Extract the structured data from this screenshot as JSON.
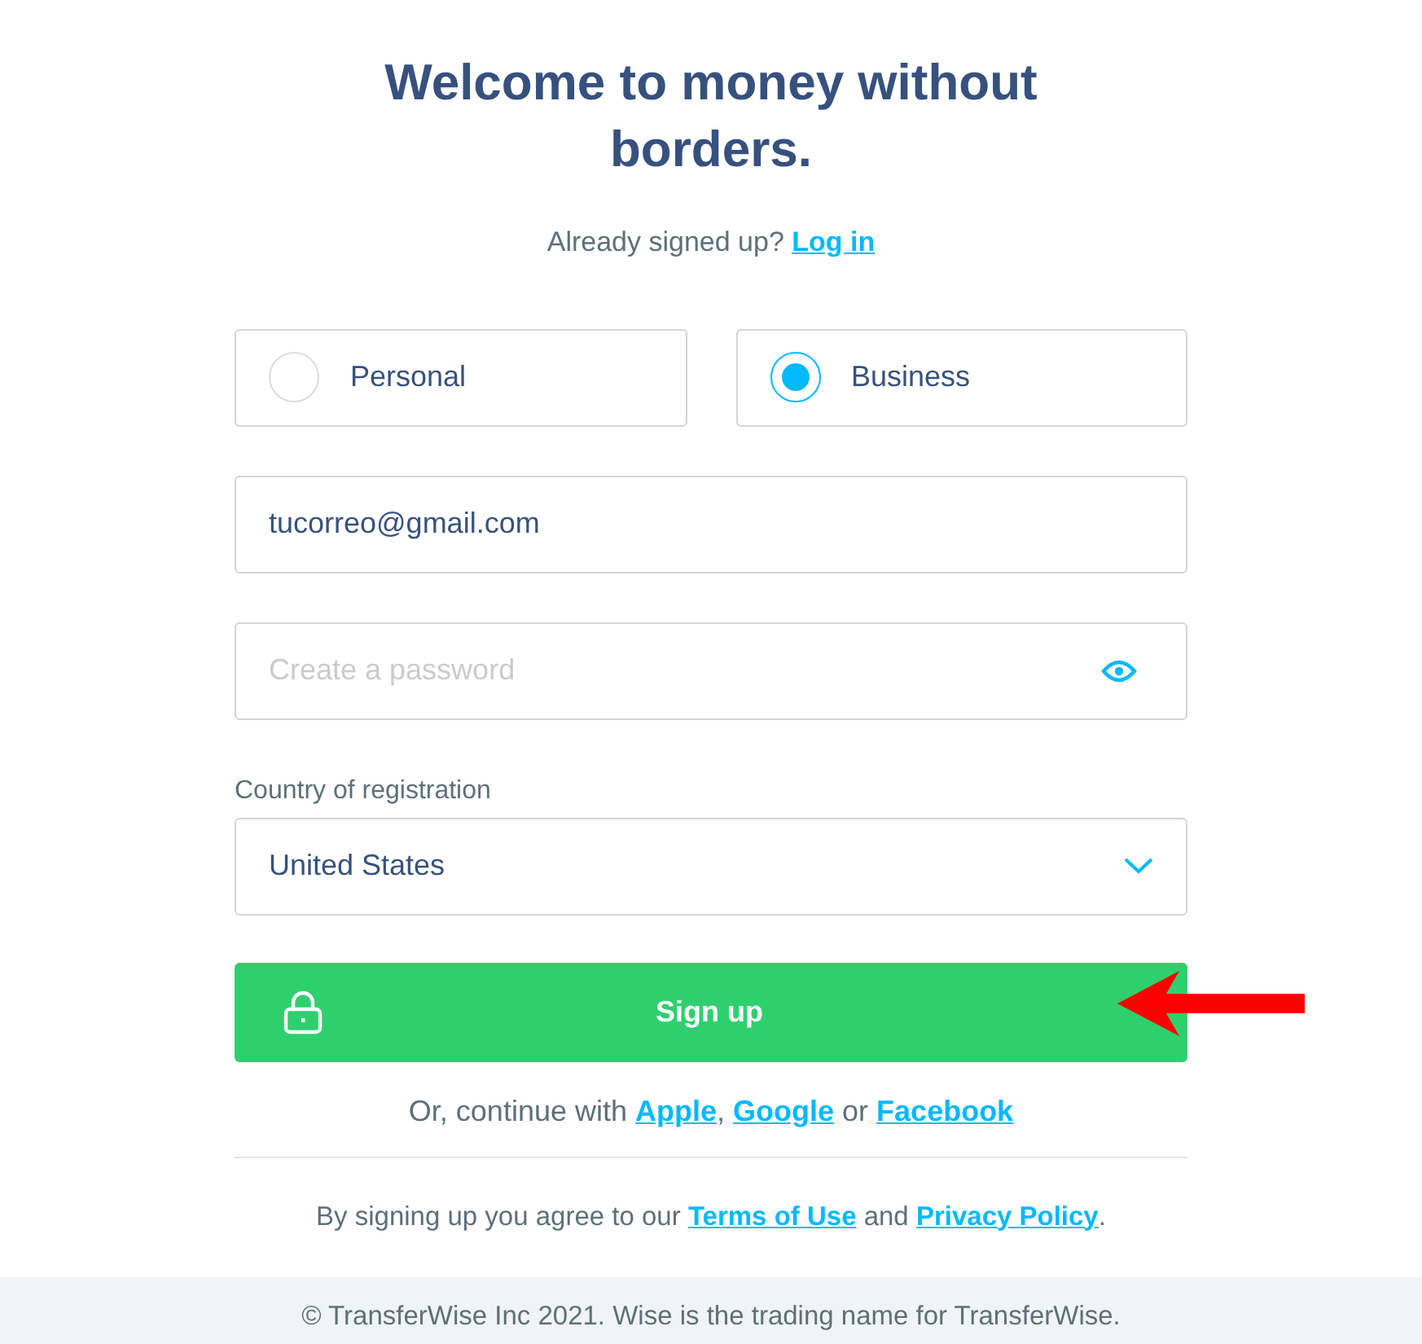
{
  "title": "Welcome to money without borders.",
  "login_prompt": [
    {
      "kind": "text",
      "text": "Already signed up? "
    },
    {
      "kind": "link",
      "text": "Log in"
    }
  ],
  "account_types": [
    {
      "label": "Personal",
      "selected": false
    },
    {
      "label": "Business",
      "selected": true
    }
  ],
  "email": {
    "value": "tucorreo@gmail.com"
  },
  "password": {
    "placeholder": "Create a password"
  },
  "country": {
    "label": "Country of registration",
    "value": "United States"
  },
  "signup_button": "Sign up",
  "continue_with": [
    {
      "kind": "text",
      "text": "Or, continue with "
    },
    {
      "kind": "link",
      "text": "Apple"
    },
    {
      "kind": "text",
      "text": ", "
    },
    {
      "kind": "link",
      "text": "Google"
    },
    {
      "kind": "text",
      "text": " or "
    },
    {
      "kind": "link",
      "text": "Facebook"
    }
  ],
  "terms": [
    {
      "kind": "text",
      "text": "By signing up you agree to our "
    },
    {
      "kind": "link",
      "text": "Terms of Use"
    },
    {
      "kind": "text",
      "text": " and "
    },
    {
      "kind": "link",
      "text": "Privacy Policy"
    },
    {
      "kind": "text",
      "text": "."
    }
  ],
  "footer": "© TransferWise Inc 2021. Wise is the trading name for TransferWise."
}
